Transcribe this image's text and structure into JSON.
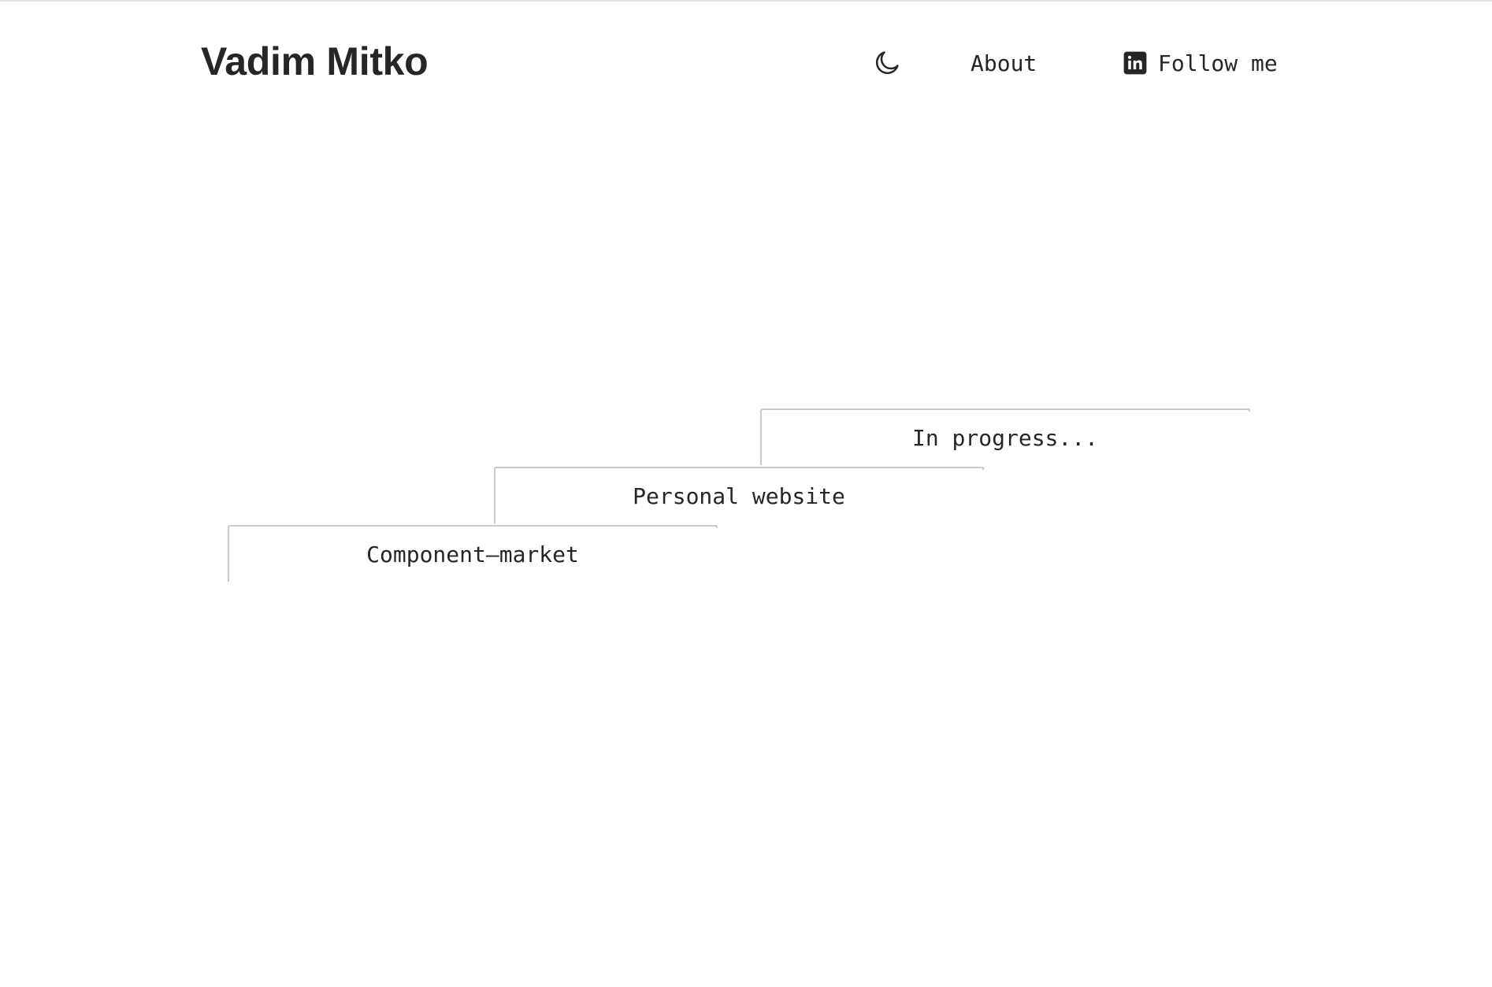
{
  "header": {
    "title": "Vadim Mitko",
    "theme_toggle_icon": "moon-icon",
    "nav": {
      "about_label": "About",
      "follow_label": "Follow me",
      "follow_icon": "linkedin-icon"
    }
  },
  "projects": {
    "steps": [
      {
        "label": "Component–market"
      },
      {
        "label": "Personal website"
      },
      {
        "label": "In progress..."
      }
    ]
  },
  "colors": {
    "text": "#262626",
    "border": "#c9c9c9",
    "background": "#ffffff"
  }
}
